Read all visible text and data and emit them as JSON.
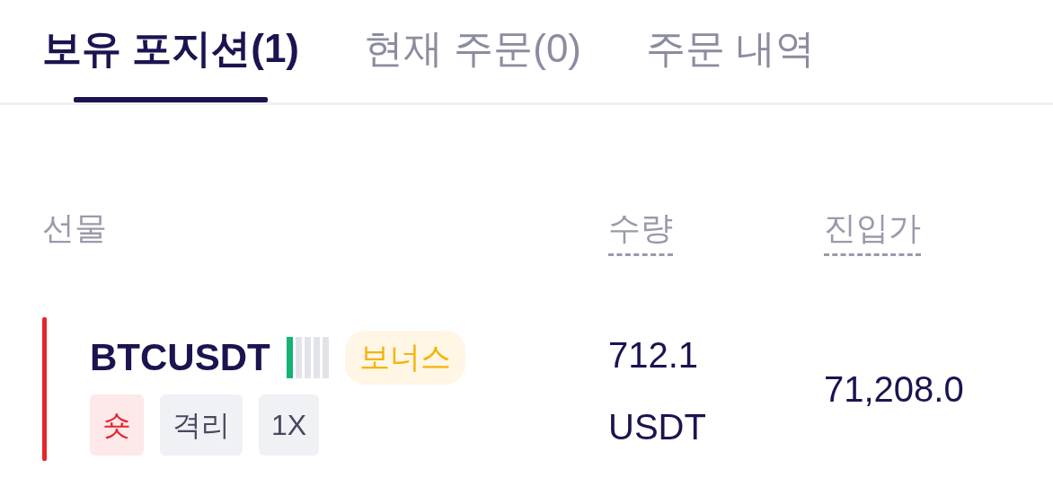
{
  "tabs": [
    {
      "label": "보유 포지션(1)",
      "selected": true
    },
    {
      "label": "현재 주문(0)",
      "selected": false
    },
    {
      "label": "주문 내역",
      "selected": false
    }
  ],
  "table": {
    "columns": [
      {
        "label": "선물",
        "dashed": false
      },
      {
        "label": "수량",
        "dashed": true
      },
      {
        "label": "진입가",
        "dashed": true
      }
    ],
    "rows": [
      {
        "symbol": "BTCUSDT",
        "risk": {
          "level": 0.2
        },
        "badge": "보너스",
        "side": "숏",
        "tags": [
          "격리",
          "1X"
        ],
        "quantity": [
          "712.1",
          "USDT"
        ],
        "entry_price": "71,208.0"
      }
    ]
  }
}
